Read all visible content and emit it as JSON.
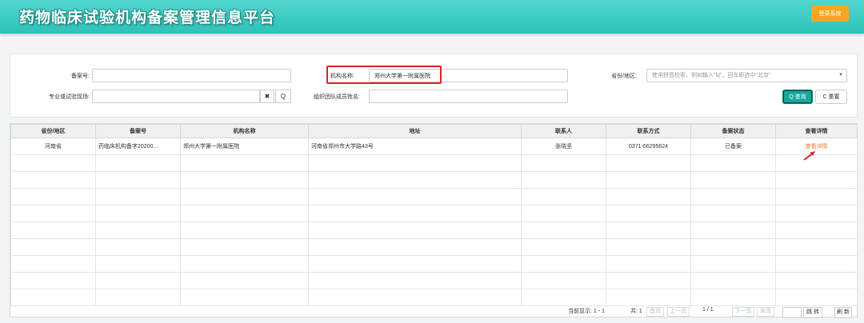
{
  "header": {
    "title": "药物临床试验机构备案管理信息平台",
    "login_label": "登录系统"
  },
  "search": {
    "record_no_label": "备案号:",
    "record_no_value": "",
    "org_name_label": "机构名称:",
    "org_name_value": "郑州大学第一附属医院",
    "province_label": "省份/地区:",
    "province_placeholder": "使用拼音检索，例如输入\"bj\"，回车即选中\"北京\"",
    "specialty_label": "专业或试验现场:",
    "specialty_value": "",
    "team_label": "组织团队成员姓名:",
    "team_value": "",
    "clear_glyph": "✖",
    "search_glyph": "Q",
    "query_label": "Q 查询",
    "reset_label": "C 重置"
  },
  "table": {
    "columns": [
      "省份/地区",
      "备案号",
      "机构名称",
      "地址",
      "联系人",
      "联系方式",
      "备案状态",
      "查看详情"
    ],
    "rows": [
      [
        "河南省",
        "药临床机构备字20200...",
        "郑州大学第一附属医院",
        "河南省郑州市大学路43号",
        "张晓坚",
        "0371-66295624",
        "已备案",
        "查看详情"
      ]
    ]
  },
  "pager": {
    "showing": "当前显示: 1 - 1",
    "total": "共: 1",
    "first": "首页",
    "prev": "上一页",
    "page_info": "1 / 1",
    "next": "下一页",
    "last": "末页",
    "go": "跳 转",
    "refresh": "刷 新"
  },
  "colors": {
    "header_bg": "#2dc2b9",
    "login_btn": "#f5a623",
    "query_btn": "#1aa69c",
    "highlight_box": "#e02020",
    "detail_link": "#f07a24"
  }
}
